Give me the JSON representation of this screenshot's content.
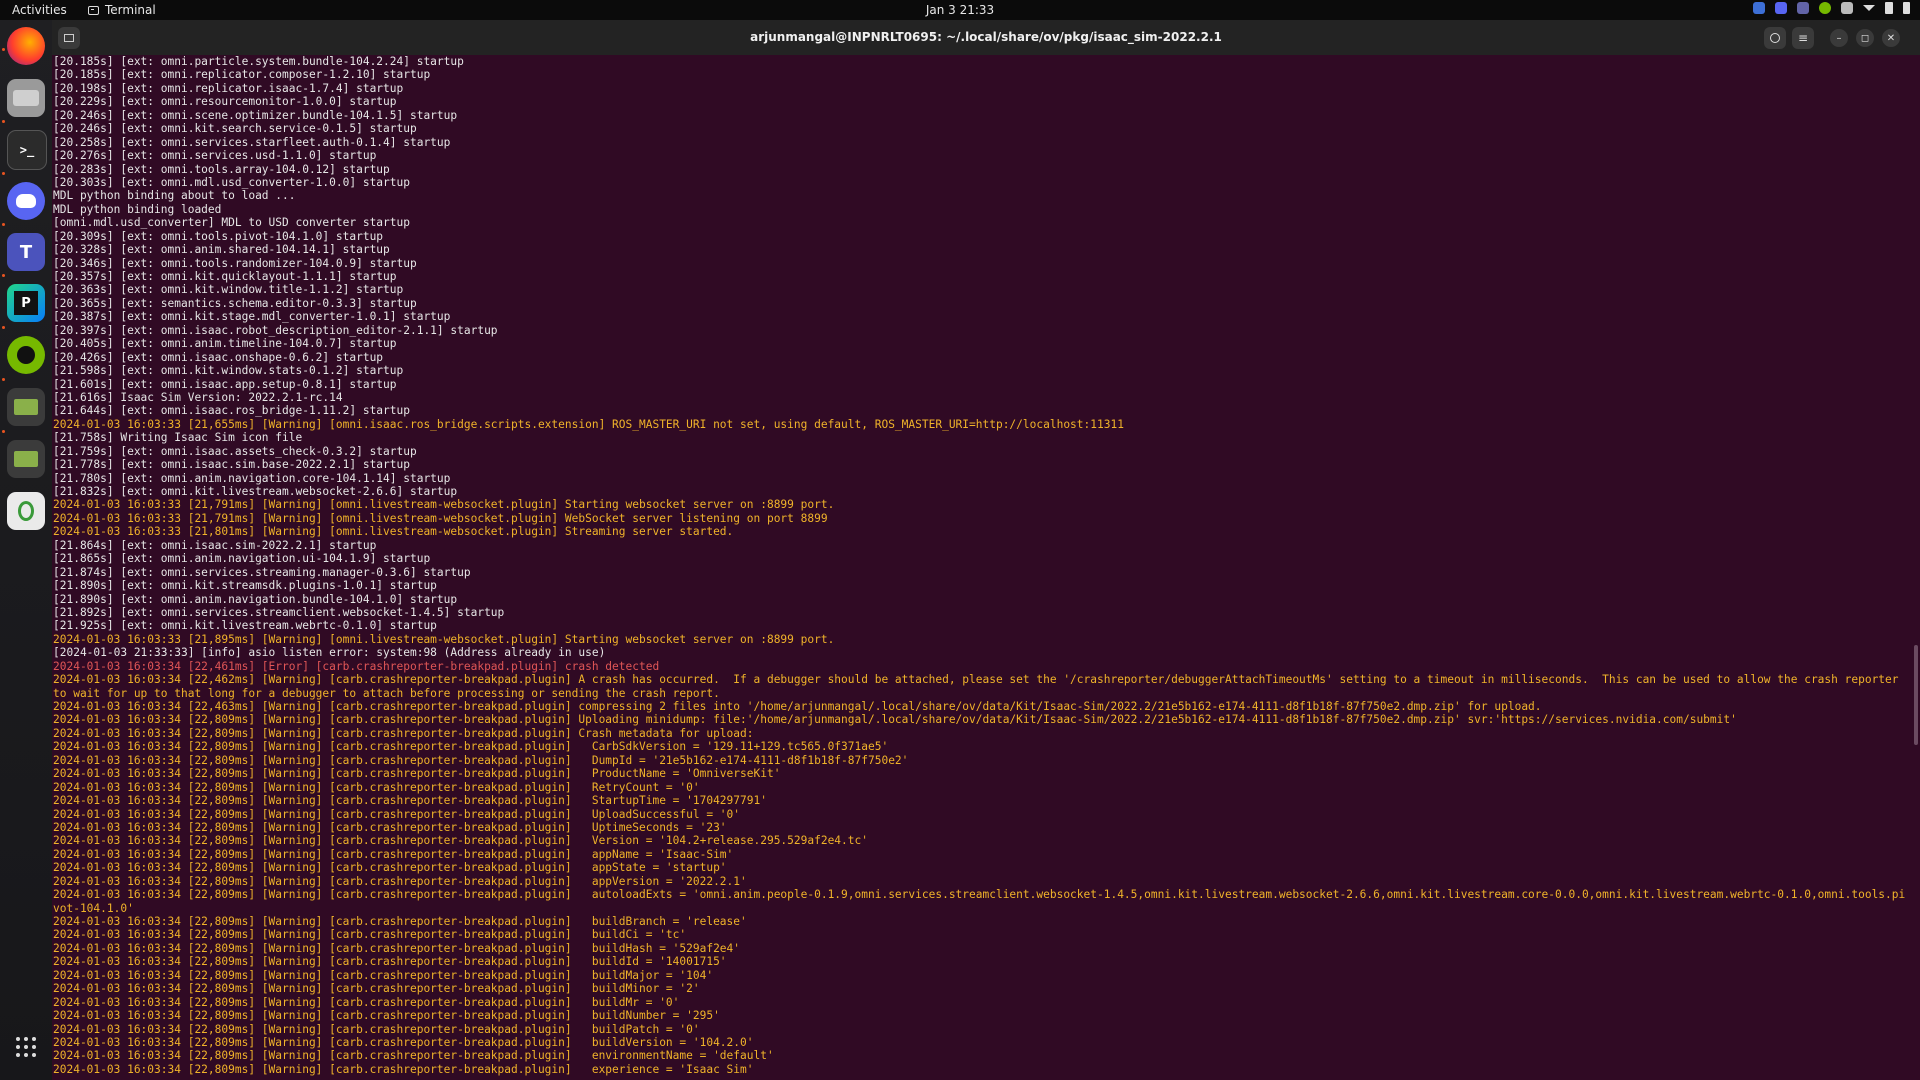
{
  "topbar": {
    "activities": "Activities",
    "app_name": "Terminal",
    "clock": "Jan 3  21:33"
  },
  "window": {
    "title": "arjunmangal@INPNRLT0695: ~/.local/share/ov/pkg/isaac_sim-2022.2.1"
  },
  "colors": {
    "terminal_bg": "#300a24",
    "warning": "#f0b32a",
    "error": "#e05656",
    "normal": "#e6e6e6"
  },
  "dock": {
    "items": [
      "firefox-icon",
      "files-icon",
      "terminal-icon",
      "discord-icon",
      "teams-icon",
      "pycharm-icon",
      "nvidia-icon",
      "omniverse-icon",
      "omniverse-icon-2",
      "trash-icon"
    ],
    "apps_grid": "show-apps-icon"
  },
  "log": [
    {
      "t": "[20.185s] [ext: omni.particle.system.bundle-104.2.24] startup",
      "k": "info"
    },
    {
      "t": "[20.185s] [ext: omni.replicator.composer-1.2.10] startup",
      "k": "info"
    },
    {
      "t": "[20.198s] [ext: omni.replicator.isaac-1.7.4] startup",
      "k": "info"
    },
    {
      "t": "[20.229s] [ext: omni.resourcemonitor-1.0.0] startup",
      "k": "info"
    },
    {
      "t": "[20.246s] [ext: omni.scene.optimizer.bundle-104.1.5] startup",
      "k": "info"
    },
    {
      "t": "[20.246s] [ext: omni.kit.search.service-0.1.5] startup",
      "k": "info"
    },
    {
      "t": "[20.258s] [ext: omni.services.starfleet.auth-0.1.4] startup",
      "k": "info"
    },
    {
      "t": "[20.276s] [ext: omni.services.usd-1.1.0] startup",
      "k": "info"
    },
    {
      "t": "[20.283s] [ext: omni.tools.array-104.0.12] startup",
      "k": "info"
    },
    {
      "t": "[20.303s] [ext: omni.mdl.usd_converter-1.0.0] startup",
      "k": "info"
    },
    {
      "t": "MDL python binding about to load ...",
      "k": "info"
    },
    {
      "t": "MDL python binding loaded",
      "k": "info"
    },
    {
      "t": "[omni.mdl.usd_converter] MDL to USD converter startup",
      "k": "info"
    },
    {
      "t": "[20.309s] [ext: omni.tools.pivot-104.1.0] startup",
      "k": "info"
    },
    {
      "t": "[20.328s] [ext: omni.anim.shared-104.14.1] startup",
      "k": "info"
    },
    {
      "t": "[20.346s] [ext: omni.tools.randomizer-104.0.9] startup",
      "k": "info"
    },
    {
      "t": "[20.357s] [ext: omni.kit.quicklayout-1.1.1] startup",
      "k": "info"
    },
    {
      "t": "[20.363s] [ext: omni.kit.window.title-1.1.2] startup",
      "k": "info"
    },
    {
      "t": "[20.365s] [ext: semantics.schema.editor-0.3.3] startup",
      "k": "info"
    },
    {
      "t": "[20.387s] [ext: omni.kit.stage.mdl_converter-1.0.1] startup",
      "k": "info"
    },
    {
      "t": "[20.397s] [ext: omni.isaac.robot_description_editor-2.1.1] startup",
      "k": "info"
    },
    {
      "t": "[20.405s] [ext: omni.anim.timeline-104.0.7] startup",
      "k": "info"
    },
    {
      "t": "[20.426s] [ext: omni.isaac.onshape-0.6.2] startup",
      "k": "info"
    },
    {
      "t": "[21.598s] [ext: omni.kit.window.stats-0.1.2] startup",
      "k": "info"
    },
    {
      "t": "[21.601s] [ext: omni.isaac.app.setup-0.8.1] startup",
      "k": "info"
    },
    {
      "t": "[21.616s] Isaac Sim Version: 2022.2.1-rc.14",
      "k": "info"
    },
    {
      "t": "[21.644s] [ext: omni.isaac.ros_bridge-1.11.2] startup",
      "k": "info"
    },
    {
      "t": "2024-01-03 16:03:33 [21,655ms] [Warning] [omni.isaac.ros_bridge.scripts.extension] ROS_MASTER_URI not set, using default, ROS_MASTER_URI=http://localhost:11311",
      "k": "warning"
    },
    {
      "t": "[21.758s] Writing Isaac Sim icon file",
      "k": "info"
    },
    {
      "t": "[21.759s] [ext: omni.isaac.assets_check-0.3.2] startup",
      "k": "info"
    },
    {
      "t": "[21.778s] [ext: omni.isaac.sim.base-2022.2.1] startup",
      "k": "info"
    },
    {
      "t": "[21.780s] [ext: omni.anim.navigation.core-104.1.14] startup",
      "k": "info"
    },
    {
      "t": "[21.832s] [ext: omni.kit.livestream.websocket-2.6.6] startup",
      "k": "info"
    },
    {
      "t": "2024-01-03 16:03:33 [21,791ms] [Warning] [omni.livestream-websocket.plugin] Starting websocket server on :8899 port.",
      "k": "warning"
    },
    {
      "t": "2024-01-03 16:03:33 [21,791ms] [Warning] [omni.livestream-websocket.plugin] WebSocket server listening on port 8899",
      "k": "warning"
    },
    {
      "t": "2024-01-03 16:03:33 [21,801ms] [Warning] [omni.livestream-websocket.plugin] Streaming server started.",
      "k": "warning"
    },
    {
      "t": "[21.864s] [ext: omni.isaac.sim-2022.2.1] startup",
      "k": "info"
    },
    {
      "t": "[21.865s] [ext: omni.anim.navigation.ui-104.1.9] startup",
      "k": "info"
    },
    {
      "t": "[21.874s] [ext: omni.services.streaming.manager-0.3.6] startup",
      "k": "info"
    },
    {
      "t": "[21.890s] [ext: omni.kit.streamsdk.plugins-1.0.1] startup",
      "k": "info"
    },
    {
      "t": "[21.890s] [ext: omni.anim.navigation.bundle-104.1.0] startup",
      "k": "info"
    },
    {
      "t": "[21.892s] [ext: omni.services.streamclient.websocket-1.4.5] startup",
      "k": "info"
    },
    {
      "t": "[21.925s] [ext: omni.kit.livestream.webrtc-0.1.0] startup",
      "k": "info"
    },
    {
      "t": "2024-01-03 16:03:33 [21,895ms] [Warning] [omni.livestream-websocket.plugin] Starting websocket server on :8899 port.",
      "k": "warning"
    },
    {
      "t": "[2024-01-03 21:33:33] [info] asio listen error: system:98 (Address already in use)",
      "k": "info"
    },
    {
      "t": "2024-01-03 16:03:34 [22,461ms] [Error] [carb.crashreporter-breakpad.plugin] crash detected",
      "k": "error"
    },
    {
      "t": "2024-01-03 16:03:34 [22,462ms] [Warning] [carb.crashreporter-breakpad.plugin] A crash has occurred.  If a debugger should be attached, please set the '/crashreporter/debuggerAttachTimeoutMs' setting to a timeout in milliseconds.  This can be used to allow the crash reporter",
      "k": "warning"
    },
    {
      "t": "to wait for up to that long for a debugger to attach before processing or sending the crash report.",
      "k": "warning"
    },
    {
      "t": "2024-01-03 16:03:34 [22,463ms] [Warning] [carb.crashreporter-breakpad.plugin] compressing 2 files into '/home/arjunmangal/.local/share/ov/data/Kit/Isaac-Sim/2022.2/21e5b162-e174-4111-d8f1b18f-87f750e2.dmp.zip' for upload.",
      "k": "warning"
    },
    {
      "t": "2024-01-03 16:03:34 [22,809ms] [Warning] [carb.crashreporter-breakpad.plugin] Uploading minidump: file:'/home/arjunmangal/.local/share/ov/data/Kit/Isaac-Sim/2022.2/21e5b162-e174-4111-d8f1b18f-87f750e2.dmp.zip' svr:'https://services.nvidia.com/submit'",
      "k": "warning"
    },
    {
      "t": "2024-01-03 16:03:34 [22,809ms] [Warning] [carb.crashreporter-breakpad.plugin] Crash metadata for upload:",
      "k": "warning"
    },
    {
      "t": "2024-01-03 16:03:34 [22,809ms] [Warning] [carb.crashreporter-breakpad.plugin]   CarbSdkVersion = '129.11+129.tc565.0f371ae5'",
      "k": "warning"
    },
    {
      "t": "2024-01-03 16:03:34 [22,809ms] [Warning] [carb.crashreporter-breakpad.plugin]   DumpId = '21e5b162-e174-4111-d8f1b18f-87f750e2'",
      "k": "warning"
    },
    {
      "t": "2024-01-03 16:03:34 [22,809ms] [Warning] [carb.crashreporter-breakpad.plugin]   ProductName = 'OmniverseKit'",
      "k": "warning"
    },
    {
      "t": "2024-01-03 16:03:34 [22,809ms] [Warning] [carb.crashreporter-breakpad.plugin]   RetryCount = '0'",
      "k": "warning"
    },
    {
      "t": "2024-01-03 16:03:34 [22,809ms] [Warning] [carb.crashreporter-breakpad.plugin]   StartupTime = '1704297791'",
      "k": "warning"
    },
    {
      "t": "2024-01-03 16:03:34 [22,809ms] [Warning] [carb.crashreporter-breakpad.plugin]   UploadSuccessful = '0'",
      "k": "warning"
    },
    {
      "t": "2024-01-03 16:03:34 [22,809ms] [Warning] [carb.crashreporter-breakpad.plugin]   UptimeSeconds = '23'",
      "k": "warning"
    },
    {
      "t": "2024-01-03 16:03:34 [22,809ms] [Warning] [carb.crashreporter-breakpad.plugin]   Version = '104.2+release.295.529af2e4.tc'",
      "k": "warning"
    },
    {
      "t": "2024-01-03 16:03:34 [22,809ms] [Warning] [carb.crashreporter-breakpad.plugin]   appName = 'Isaac-Sim'",
      "k": "warning"
    },
    {
      "t": "2024-01-03 16:03:34 [22,809ms] [Warning] [carb.crashreporter-breakpad.plugin]   appState = 'startup'",
      "k": "warning"
    },
    {
      "t": "2024-01-03 16:03:34 [22,809ms] [Warning] [carb.crashreporter-breakpad.plugin]   appVersion = '2022.2.1'",
      "k": "warning"
    },
    {
      "t": "2024-01-03 16:03:34 [22,809ms] [Warning] [carb.crashreporter-breakpad.plugin]   autoloadExts = 'omni.anim.people-0.1.9,omni.services.streamclient.websocket-1.4.5,omni.kit.livestream.websocket-2.6.6,omni.kit.livestream.core-0.0.0,omni.kit.livestream.webrtc-0.1.0,omni.tools.pi",
      "k": "warning"
    },
    {
      "t": "vot-104.1.0'",
      "k": "warning"
    },
    {
      "t": "2024-01-03 16:03:34 [22,809ms] [Warning] [carb.crashreporter-breakpad.plugin]   buildBranch = 'release'",
      "k": "warning"
    },
    {
      "t": "2024-01-03 16:03:34 [22,809ms] [Warning] [carb.crashreporter-breakpad.plugin]   buildCi = 'tc'",
      "k": "warning"
    },
    {
      "t": "2024-01-03 16:03:34 [22,809ms] [Warning] [carb.crashreporter-breakpad.plugin]   buildHash = '529af2e4'",
      "k": "warning"
    },
    {
      "t": "2024-01-03 16:03:34 [22,809ms] [Warning] [carb.crashreporter-breakpad.plugin]   buildId = '14001715'",
      "k": "warning"
    },
    {
      "t": "2024-01-03 16:03:34 [22,809ms] [Warning] [carb.crashreporter-breakpad.plugin]   buildMajor = '104'",
      "k": "warning"
    },
    {
      "t": "2024-01-03 16:03:34 [22,809ms] [Warning] [carb.crashreporter-breakpad.plugin]   buildMinor = '2'",
      "k": "warning"
    },
    {
      "t": "2024-01-03 16:03:34 [22,809ms] [Warning] [carb.crashreporter-breakpad.plugin]   buildMr = '0'",
      "k": "warning"
    },
    {
      "t": "2024-01-03 16:03:34 [22,809ms] [Warning] [carb.crashreporter-breakpad.plugin]   buildNumber = '295'",
      "k": "warning"
    },
    {
      "t": "2024-01-03 16:03:34 [22,809ms] [Warning] [carb.crashreporter-breakpad.plugin]   buildPatch = '0'",
      "k": "warning"
    },
    {
      "t": "2024-01-03 16:03:34 [22,809ms] [Warning] [carb.crashreporter-breakpad.plugin]   buildVersion = '104.2.0'",
      "k": "warning"
    },
    {
      "t": "2024-01-03 16:03:34 [22,809ms] [Warning] [carb.crashreporter-breakpad.plugin]   environmentName = 'default'",
      "k": "warning"
    },
    {
      "t": "2024-01-03 16:03:34 [22,809ms] [Warning] [carb.crashreporter-breakpad.plugin]   experience = 'Isaac Sim'",
      "k": "warning"
    }
  ]
}
